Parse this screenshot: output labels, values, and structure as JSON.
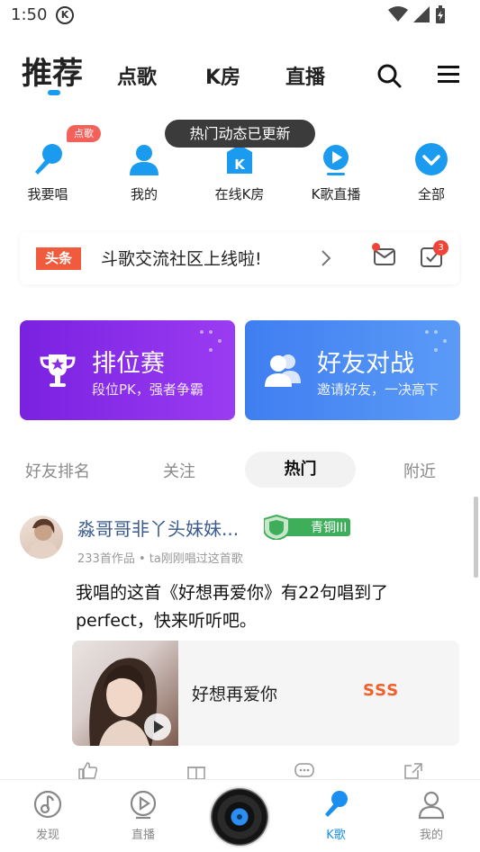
{
  "status_bar": {
    "time": "1:50",
    "k_label": "K"
  },
  "top_nav": {
    "tabs": [
      "推荐",
      "点歌",
      "K房",
      "直播"
    ],
    "active_index": 0
  },
  "toast": "热门动态已更新",
  "quick_actions": [
    {
      "label": "我要唱",
      "icon": "microphone-icon",
      "badge": "点歌"
    },
    {
      "label": "我的",
      "icon": "person-icon"
    },
    {
      "label": "在线K房",
      "icon": "k-room-icon"
    },
    {
      "label": "K歌直播",
      "icon": "live-play-icon"
    },
    {
      "label": "全部",
      "icon": "chevron-down-icon"
    }
  ],
  "headline": {
    "tag": "头条",
    "text": "斗歌交流社区上线啦!",
    "task_count": "3"
  },
  "cards": [
    {
      "title": "排位赛",
      "subtitle": "段位PK，强者争霸",
      "color": "#8a2ee8"
    },
    {
      "title": "好友对战",
      "subtitle": "邀请好友，一决高下",
      "color": "#4a89f2"
    }
  ],
  "feed_tabs": [
    "好友排名",
    "关注",
    "热门",
    "附近"
  ],
  "feed_active": "热门",
  "post": {
    "user_name": "淼哥哥非丫头妹妹...",
    "rank": "青铜III",
    "meta": "233首作品 • ta刚刚唱过这首歌",
    "text": "我唱的这首《好想再爱你》有22句唱到了perfect，快来听听吧。",
    "song_title": "好想再爱你",
    "song_score": "SSS"
  },
  "bottom_nav": [
    {
      "label": "发现",
      "icon": "discover-icon"
    },
    {
      "label": "直播",
      "icon": "live-icon"
    },
    {
      "label": "",
      "icon": "vinyl-record-icon"
    },
    {
      "label": "K歌",
      "icon": "karaoke-icon"
    },
    {
      "label": "我的",
      "icon": "profile-icon"
    }
  ],
  "colors": {
    "accent": "#1a9bf0",
    "rank_bg": "#3fae5b",
    "score": "#f0602a",
    "hot_badge": "#f4615b"
  }
}
